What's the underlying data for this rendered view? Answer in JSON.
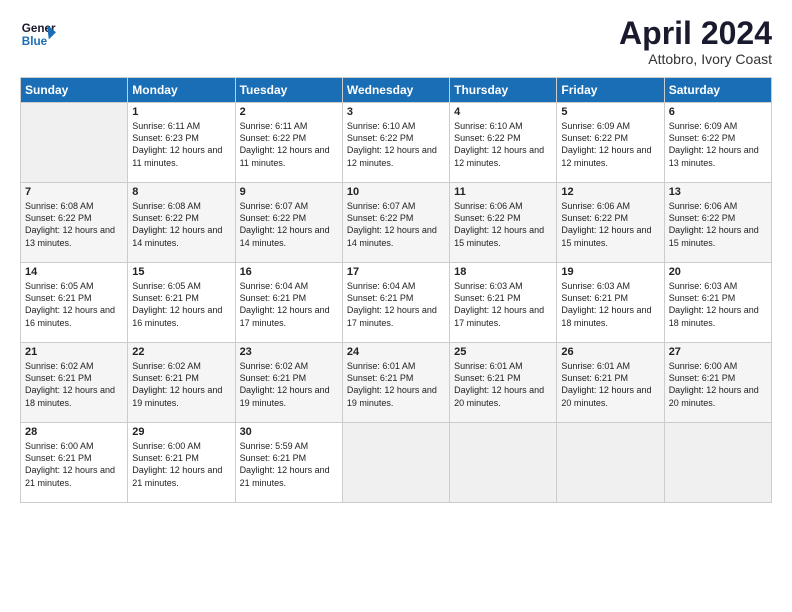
{
  "header": {
    "logo_line1": "General",
    "logo_line2": "Blue",
    "month": "April 2024",
    "location": "Attobro, Ivory Coast"
  },
  "days_of_week": [
    "Sunday",
    "Monday",
    "Tuesday",
    "Wednesday",
    "Thursday",
    "Friday",
    "Saturday"
  ],
  "weeks": [
    [
      {
        "day": "",
        "empty": true
      },
      {
        "day": "1",
        "sunrise": "6:11 AM",
        "sunset": "6:23 PM",
        "daylight": "12 hours and 11 minutes."
      },
      {
        "day": "2",
        "sunrise": "6:11 AM",
        "sunset": "6:22 PM",
        "daylight": "12 hours and 11 minutes."
      },
      {
        "day": "3",
        "sunrise": "6:10 AM",
        "sunset": "6:22 PM",
        "daylight": "12 hours and 12 minutes."
      },
      {
        "day": "4",
        "sunrise": "6:10 AM",
        "sunset": "6:22 PM",
        "daylight": "12 hours and 12 minutes."
      },
      {
        "day": "5",
        "sunrise": "6:09 AM",
        "sunset": "6:22 PM",
        "daylight": "12 hours and 12 minutes."
      },
      {
        "day": "6",
        "sunrise": "6:09 AM",
        "sunset": "6:22 PM",
        "daylight": "12 hours and 13 minutes."
      }
    ],
    [
      {
        "day": "7",
        "sunrise": "6:08 AM",
        "sunset": "6:22 PM",
        "daylight": "12 hours and 13 minutes."
      },
      {
        "day": "8",
        "sunrise": "6:08 AM",
        "sunset": "6:22 PM",
        "daylight": "12 hours and 14 minutes."
      },
      {
        "day": "9",
        "sunrise": "6:07 AM",
        "sunset": "6:22 PM",
        "daylight": "12 hours and 14 minutes."
      },
      {
        "day": "10",
        "sunrise": "6:07 AM",
        "sunset": "6:22 PM",
        "daylight": "12 hours and 14 minutes."
      },
      {
        "day": "11",
        "sunrise": "6:06 AM",
        "sunset": "6:22 PM",
        "daylight": "12 hours and 15 minutes."
      },
      {
        "day": "12",
        "sunrise": "6:06 AM",
        "sunset": "6:22 PM",
        "daylight": "12 hours and 15 minutes."
      },
      {
        "day": "13",
        "sunrise": "6:06 AM",
        "sunset": "6:22 PM",
        "daylight": "12 hours and 15 minutes."
      }
    ],
    [
      {
        "day": "14",
        "sunrise": "6:05 AM",
        "sunset": "6:21 PM",
        "daylight": "12 hours and 16 minutes."
      },
      {
        "day": "15",
        "sunrise": "6:05 AM",
        "sunset": "6:21 PM",
        "daylight": "12 hours and 16 minutes."
      },
      {
        "day": "16",
        "sunrise": "6:04 AM",
        "sunset": "6:21 PM",
        "daylight": "12 hours and 17 minutes."
      },
      {
        "day": "17",
        "sunrise": "6:04 AM",
        "sunset": "6:21 PM",
        "daylight": "12 hours and 17 minutes."
      },
      {
        "day": "18",
        "sunrise": "6:03 AM",
        "sunset": "6:21 PM",
        "daylight": "12 hours and 17 minutes."
      },
      {
        "day": "19",
        "sunrise": "6:03 AM",
        "sunset": "6:21 PM",
        "daylight": "12 hours and 18 minutes."
      },
      {
        "day": "20",
        "sunrise": "6:03 AM",
        "sunset": "6:21 PM",
        "daylight": "12 hours and 18 minutes."
      }
    ],
    [
      {
        "day": "21",
        "sunrise": "6:02 AM",
        "sunset": "6:21 PM",
        "daylight": "12 hours and 18 minutes."
      },
      {
        "day": "22",
        "sunrise": "6:02 AM",
        "sunset": "6:21 PM",
        "daylight": "12 hours and 19 minutes."
      },
      {
        "day": "23",
        "sunrise": "6:02 AM",
        "sunset": "6:21 PM",
        "daylight": "12 hours and 19 minutes."
      },
      {
        "day": "24",
        "sunrise": "6:01 AM",
        "sunset": "6:21 PM",
        "daylight": "12 hours and 19 minutes."
      },
      {
        "day": "25",
        "sunrise": "6:01 AM",
        "sunset": "6:21 PM",
        "daylight": "12 hours and 20 minutes."
      },
      {
        "day": "26",
        "sunrise": "6:01 AM",
        "sunset": "6:21 PM",
        "daylight": "12 hours and 20 minutes."
      },
      {
        "day": "27",
        "sunrise": "6:00 AM",
        "sunset": "6:21 PM",
        "daylight": "12 hours and 20 minutes."
      }
    ],
    [
      {
        "day": "28",
        "sunrise": "6:00 AM",
        "sunset": "6:21 PM",
        "daylight": "12 hours and 21 minutes."
      },
      {
        "day": "29",
        "sunrise": "6:00 AM",
        "sunset": "6:21 PM",
        "daylight": "12 hours and 21 minutes."
      },
      {
        "day": "30",
        "sunrise": "5:59 AM",
        "sunset": "6:21 PM",
        "daylight": "12 hours and 21 minutes."
      },
      {
        "day": "",
        "empty": true
      },
      {
        "day": "",
        "empty": true
      },
      {
        "day": "",
        "empty": true
      },
      {
        "day": "",
        "empty": true
      }
    ]
  ]
}
